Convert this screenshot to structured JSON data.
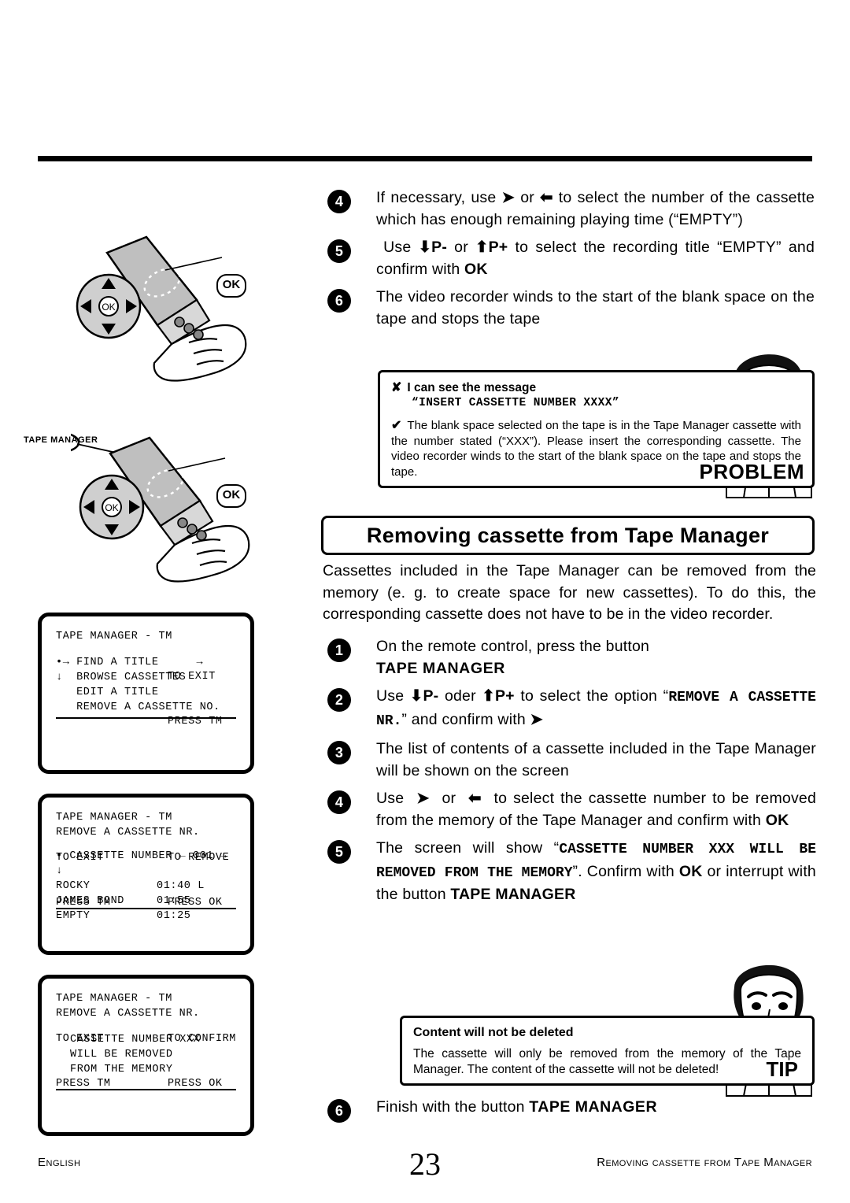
{
  "page": {
    "number": "23",
    "footer_left": "English",
    "footer_right": "Removing cassette from Tape Manager"
  },
  "steps_top": [
    {
      "num": "4",
      "text": "If necessary, use ➜ or ⬅ to select the number of the cassette which has enough remaining playing time (“EMPTY”)"
    },
    {
      "num": "5",
      "text": "Use ⬇P- or ⬆P+ to select the recording title “EMPTY” and confirm with OK"
    },
    {
      "num": "6",
      "text": "The video recorder winds to the start of the blank space on the tape and stops the tape"
    }
  ],
  "problem_box": {
    "cross_mark": "✘",
    "check_mark": "✔",
    "line1": "I can see the message",
    "line2": "“INSERT CASSETTE NUMBER XXXX”",
    "line3": "The blank space selected on the tape is in the Tape Manager cassette with the number stated (“XXX”). Please insert the corresponding cassette. The video recorder winds to the start of the blank space on the tape and stops the tape.",
    "label": "PROBLEM"
  },
  "section": {
    "title": "Removing cassette from Tape Manager",
    "intro": "Cassettes included in the Tape Manager can be removed from the memory (e. g. to create space for new cassettes). To do this, the corresponding cassette does not have to be in the video recorder."
  },
  "steps_main": [
    {
      "num": "1",
      "text": "On the remote control, press the button ",
      "bold": "TAPE MANAGER"
    },
    {
      "num": "2",
      "text": "Use ⬇P- oder ⬆P+ to select the option “REMOVE A CASSETTE NR.” and confirm with ➜"
    },
    {
      "num": "3",
      "text": "The list of contents of a cassette included in the Tape Manager will be shown on the screen"
    },
    {
      "num": "4",
      "text": "Use ➜ or ⬅ to select the cassette number to be removed from the memory of the Tape Manager and confirm with OK"
    },
    {
      "num": "5",
      "text": "The screen will show “CASSETTE NUMBER XXX WILL BE REMOVED FROM THE MEMORY”. Confirm with OK or interrupt with the button TAPE MANAGER"
    }
  ],
  "tip_box": {
    "head": "Content will not be deleted",
    "body": "The cassette will only be removed from the memory of the Tape Manager. The content of the cassette will not be deleted!",
    "label": "TIP"
  },
  "final_step": {
    "num": "6",
    "text": "Finish with the button ",
    "bold": "TAPE MANAGER"
  },
  "remote_labels": {
    "ok": "OK",
    "tape_manager_tag": "TAPE MANAGER"
  },
  "osd_screens": [
    {
      "id": "osd1",
      "title": "TAPE MANAGER - TM",
      "menu": [
        {
          "marker": "•→",
          "label": "FIND A TITLE",
          "right": "→"
        },
        {
          "marker": "↓",
          "label": "BROWSE CASSETTES",
          "right": ""
        },
        {
          "marker": "",
          "label": "EDIT A TITLE",
          "right": ""
        },
        {
          "marker": "",
          "label": "REMOVE A CASSETTE NO.",
          "right": ""
        }
      ],
      "foot_left_1": "",
      "foot_left_2": "",
      "foot_right_1": "TO EXIT",
      "foot_right_2": "PRESS TM"
    },
    {
      "id": "osd2",
      "title": "TAPE MANAGER - TM",
      "subtitle": "REMOVE A CASSETTE NR.",
      "selector": {
        "marker": "•",
        "label": "CASSETTE NUMBER",
        "left_arrow": "←",
        "value": "001",
        "right_arrow": "→",
        "down": "↓"
      },
      "entries": [
        {
          "name": "ROCKY",
          "time": "01:40",
          "flag": "L"
        },
        {
          "name": "JAMES BOND",
          "time": "01:55",
          "flag": ""
        },
        {
          "name": "EMPTY",
          "time": "01:25",
          "flag": ""
        }
      ],
      "foot_left_1": "TO EXIT",
      "foot_left_2": "PRESS TM",
      "foot_right_1": "TO REMOVE",
      "foot_right_2": "PRESS OK"
    },
    {
      "id": "osd3",
      "title": "TAPE MANAGER - TM",
      "subtitle": "REMOVE A CASSETTE NR.",
      "message": [
        "CASSETTE NUMBER XXX",
        "WILL BE REMOVED",
        "FROM THE MEMORY"
      ],
      "foot_left_1": "TO EXIT",
      "foot_left_2": "PRESS TM",
      "foot_right_1": "TO CONFIRM",
      "foot_right_2": "PRESS OK"
    }
  ]
}
